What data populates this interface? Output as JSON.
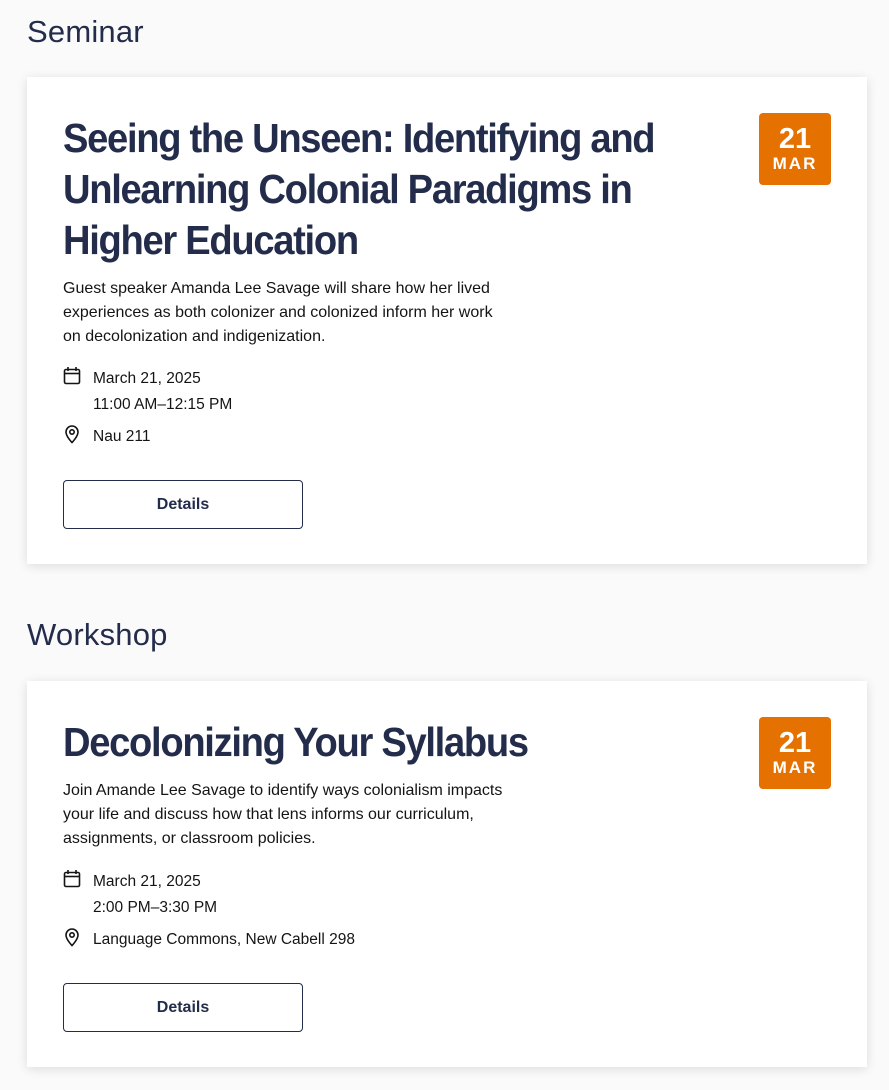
{
  "events": [
    {
      "category": "Seminar",
      "title_lines": [
        "Seeing the Unseen: Identifying and",
        "Unlearning Colonial Paradigms in",
        "Higher Education"
      ],
      "description_lines": [
        "Guest speaker Amanda Lee Savage will share how her lived",
        "experiences as both colonizer and colonized inform her work",
        "on decolonization and indigenization."
      ],
      "date": "March 21, 2025",
      "time": "11:00 AM–12:15 PM",
      "location": "Nau 211",
      "badge_day": "21",
      "badge_month": "MAR",
      "button_label": "Details",
      "icons": {
        "date": "calendar-icon",
        "location": "map-pin-icon"
      }
    },
    {
      "category": "Workshop",
      "title_lines": [
        "Decolonizing Your Syllabus"
      ],
      "description_lines": [
        "Join Amande Lee Savage to identify ways colonialism impacts",
        "your life and discuss how that lens informs our curriculum,",
        "assignments, or classroom policies."
      ],
      "date": "March 21, 2025",
      "time": "2:00 PM–3:30 PM",
      "location": "Language Commons, New Cabell 298",
      "badge_day": "21",
      "badge_month": "MAR",
      "button_label": "Details",
      "icons": {
        "date": "calendar-icon",
        "location": "map-pin-icon"
      }
    }
  ],
  "colors": {
    "heading": "#232d4b",
    "badge": "#e57200",
    "card_background": "#ffffff",
    "page_background": "#fafafa"
  }
}
